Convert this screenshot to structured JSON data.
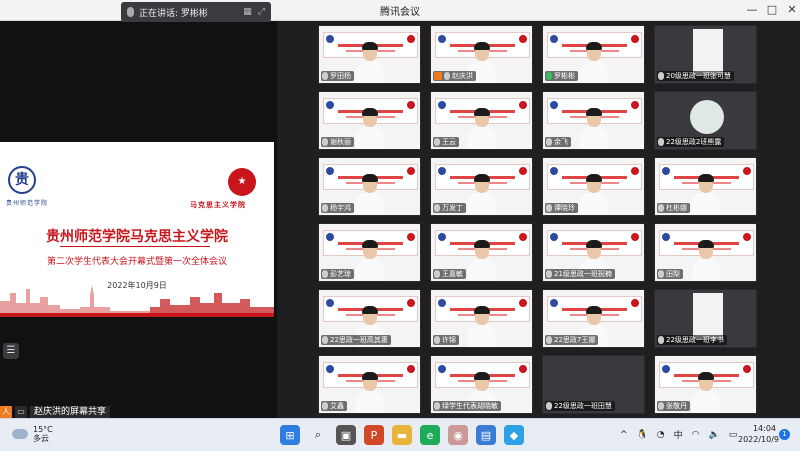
{
  "window": {
    "title": "腾讯会议",
    "controls": [
      "—",
      "□",
      "✕"
    ]
  },
  "speaking": {
    "label": "正在讲话: 罗彬彬",
    "mic_icon": "mic-icon"
  },
  "slide": {
    "school_logo_text": "贵州师范学院",
    "college_logo_text": "马克思主义学院",
    "main_title": "贵州师范学院马克思主义学院",
    "sub_title": "第二次学生代表大会开幕式暨第一次全体会议",
    "date": "2022年10月9日"
  },
  "share_bar": {
    "label": "赵庆洪的屏幕共享"
  },
  "participants": [
    {
      "name": "罗田杨",
      "cam": "banner"
    },
    {
      "name": "赵庆洪",
      "cam": "banner",
      "avatar": true
    },
    {
      "name": "罗彬彬",
      "cam": "banner",
      "mic_on": true
    },
    {
      "name": "20级思政一班张可慧",
      "cam": "inner"
    },
    {
      "name": "谢秋丽",
      "cam": "banner"
    },
    {
      "name": "王云",
      "cam": "banner"
    },
    {
      "name": "余飞",
      "cam": "banner"
    },
    {
      "name": "22级思政2班熊露",
      "cam": "dark-photo"
    },
    {
      "name": "杨宇鸿",
      "cam": "banner"
    },
    {
      "name": "万发丁",
      "cam": "banner"
    },
    {
      "name": "谭晓玲",
      "cam": "banner"
    },
    {
      "name": "杜彬娜",
      "cam": "banner"
    },
    {
      "name": "彭艺琼",
      "cam": "banner"
    },
    {
      "name": "王嘉敏",
      "cam": "banner"
    },
    {
      "name": "21级思政一班祝楠",
      "cam": "banner"
    },
    {
      "name": "田梨",
      "cam": "banner"
    },
    {
      "name": "22思政一班高其惠",
      "cam": "banner"
    },
    {
      "name": "许锦",
      "cam": "banner"
    },
    {
      "name": "22思政7王娜",
      "cam": "banner"
    },
    {
      "name": "22级思政一班李书",
      "cam": "inner"
    },
    {
      "name": "艾鑫",
      "cam": "banner"
    },
    {
      "name": "绿学生代表胡晓敏",
      "cam": "banner"
    },
    {
      "name": "22级思政一班田慧",
      "cam": "dark"
    },
    {
      "name": "张敬丹",
      "cam": "banner"
    }
  ],
  "taskbar": {
    "weather_temp": "15°C",
    "weather_desc": "多云",
    "tray_items": [
      "^",
      "中"
    ],
    "time": "14:04",
    "date": "2022/10/9",
    "notif_count": "1"
  }
}
